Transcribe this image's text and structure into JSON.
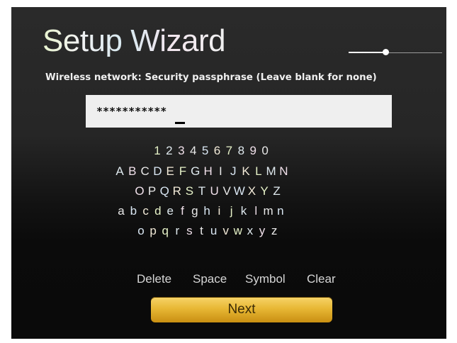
{
  "wizard": {
    "title": "Setup Wizard",
    "subtitle": "Wireless network: Security passphrase (Leave blank for none)",
    "progress_fraction": 0.4
  },
  "passphrase": {
    "value": "***********"
  },
  "keyboard": {
    "rows": [
      [
        "1",
        "2",
        "3",
        "4",
        "5",
        "6",
        "7",
        "8",
        "9",
        "0"
      ],
      [
        "A",
        "B",
        "C",
        "D",
        "E",
        "F",
        "G",
        "H",
        "I",
        "J",
        "K",
        "L",
        "M",
        "N"
      ],
      [
        "O",
        "P",
        "Q",
        "R",
        "S",
        "T",
        "U",
        "V",
        "W",
        "X",
        "Y",
        "Z"
      ],
      [
        "a",
        "b",
        "c",
        "d",
        "e",
        "f",
        "g",
        "h",
        "i",
        "j",
        "k",
        "l",
        "m",
        "n"
      ],
      [
        "o",
        "p",
        "q",
        "r",
        "s",
        "t",
        "u",
        "v",
        "w",
        "x",
        "y",
        "z"
      ]
    ]
  },
  "actions": {
    "delete": "Delete",
    "space": "Space",
    "symbol": "Symbol",
    "clear": "Clear"
  },
  "next_label": "Next",
  "colors": {
    "next_button": "#e8b835",
    "field_background": "#efefef"
  }
}
